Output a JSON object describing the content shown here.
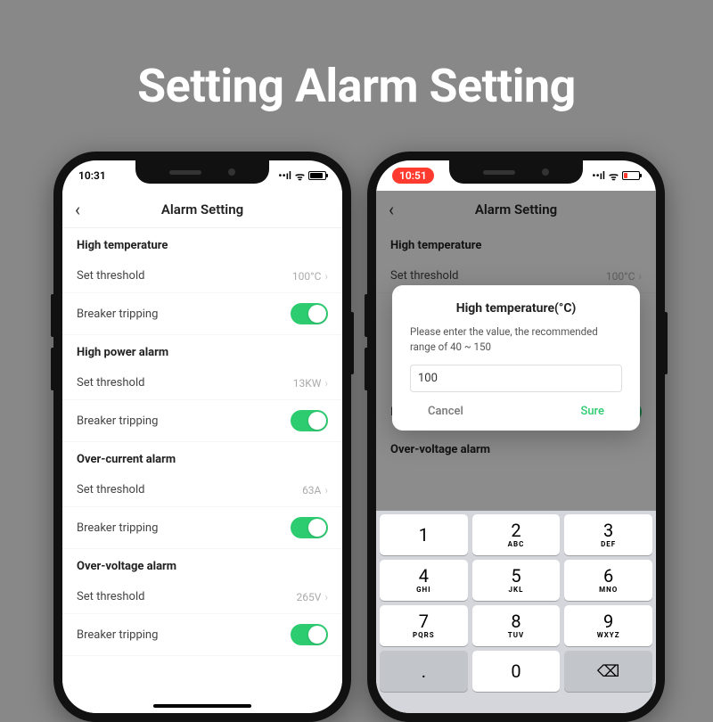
{
  "heading": "Setting Alarm Setting",
  "phoneA": {
    "time": "10:31",
    "title": "Alarm Setting",
    "sections": [
      {
        "header": "High temperature",
        "thresholdLabel": "Set threshold",
        "thresholdValue": "100°C",
        "breakerLabel": "Breaker tripping"
      },
      {
        "header": "High power alarm",
        "thresholdLabel": "Set threshold",
        "thresholdValue": "13KW",
        "breakerLabel": "Breaker tripping"
      },
      {
        "header": "Over-current alarm",
        "thresholdLabel": "Set threshold",
        "thresholdValue": "63A",
        "breakerLabel": "Breaker tripping"
      },
      {
        "header": "Over-voltage alarm",
        "thresholdLabel": "Set threshold",
        "thresholdValue": "265V",
        "breakerLabel": "Breaker tripping"
      }
    ]
  },
  "phoneB": {
    "time": "10:51",
    "title": "Alarm Setting",
    "bg": {
      "s1": "High temperature",
      "threshLabel": "Set threshold",
      "threshVal": "100°C",
      "breaker": "Breaker tripping",
      "s2": "Over-voltage alarm"
    },
    "dialog": {
      "title": "High temperature(°C)",
      "message": "Please enter the value, the recommended range of 40 ~ 150",
      "value": "100",
      "cancel": "Cancel",
      "ok": "Sure"
    },
    "keys": [
      {
        "m": "1",
        "s": ""
      },
      {
        "m": "2",
        "s": "ABC"
      },
      {
        "m": "3",
        "s": "DEF"
      },
      {
        "m": "4",
        "s": "GHI"
      },
      {
        "m": "5",
        "s": "JKL"
      },
      {
        "m": "6",
        "s": "MNO"
      },
      {
        "m": "7",
        "s": "PQRS"
      },
      {
        "m": "8",
        "s": "TUV"
      },
      {
        "m": "9",
        "s": "WXYZ"
      },
      {
        "m": ".",
        "s": "",
        "fn": true
      },
      {
        "m": "0",
        "s": ""
      },
      {
        "m": "⌫",
        "s": "",
        "fn": true,
        "back": true
      }
    ]
  }
}
